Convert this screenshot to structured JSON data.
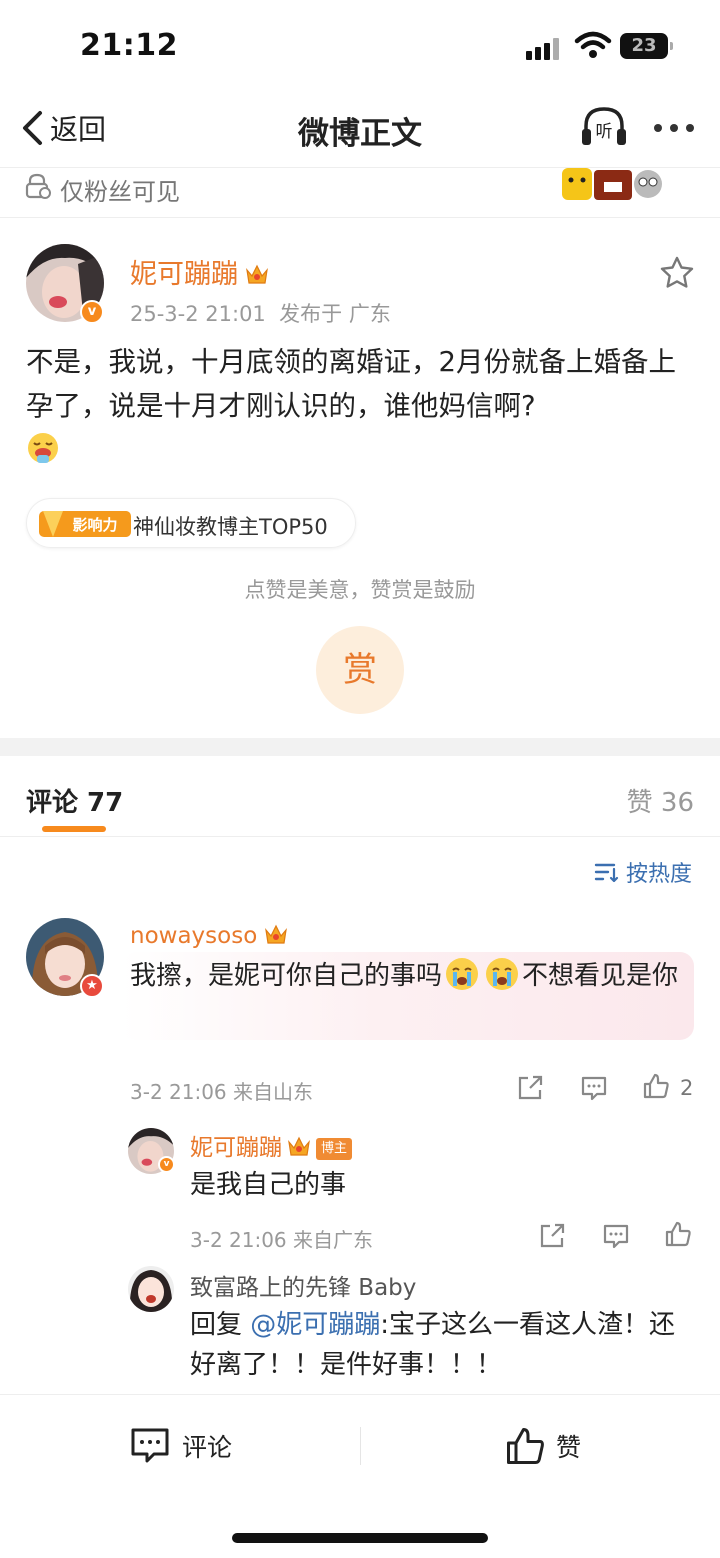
{
  "status_bar": {
    "time": "21:12",
    "battery": "23"
  },
  "nav": {
    "back_label": "返回",
    "title": "微博正文",
    "listen_label": "听"
  },
  "visibility": "仅粉丝可见",
  "post": {
    "author": "妮可蹦蹦",
    "verified_badge": "v",
    "time": "25-3-2 21:01",
    "location": "发布于 广东",
    "text": "不是，我说，十月底领的离婚证，2月份就备上婚备上孕了，说是十月才刚认识的，谁他妈信啊?",
    "tag_logo": "影响力",
    "tag_text": "神仙妆教博主TOP50",
    "reward_hint": "点赞是美意，赞赏是鼓励",
    "reward_button": "赏"
  },
  "comments_header": {
    "comments_label": "评论 77",
    "likes_label": "赞 36",
    "sort_label": "按热度"
  },
  "comments": [
    {
      "author": "nowaysoso",
      "text_a": "我擦，是妮可你自己的事吗",
      "text_b": "不想看见是你",
      "time": "3-2 21:06 来自山东",
      "like_count": "2"
    }
  ],
  "replies": [
    {
      "author": "妮可蹦蹦",
      "badge": "博主",
      "text": "是我自己的事",
      "time": "3-2 21:06 来自广东"
    },
    {
      "author": "致富路上的先锋 Baby",
      "reply_prefix": "回复 ",
      "mention": "@妮可蹦蹦",
      "text": ":宝子这么一看这人渣！还好离了！！是件好事！！！"
    }
  ],
  "bottom_bar": {
    "comment_label": "评论",
    "like_label": "赞"
  },
  "colors": {
    "accent": "#e8792c",
    "link": "#3b6fb0",
    "badge_orange": "#f78a1d"
  }
}
